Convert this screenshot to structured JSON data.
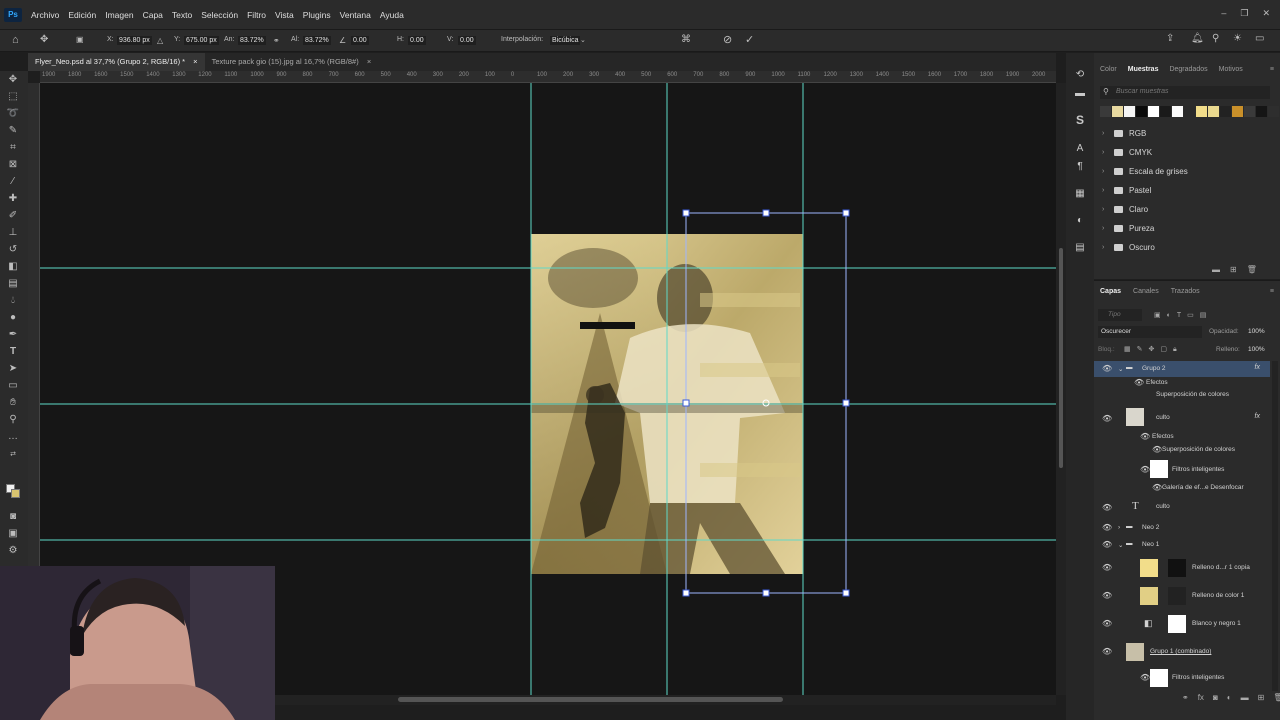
{
  "menubar": {
    "logo": "Ps",
    "items": [
      "Archivo",
      "Edición",
      "Imagen",
      "Capa",
      "Texto",
      "Selección",
      "Filtro",
      "Vista",
      "Plugins",
      "Ventana",
      "Ayuda"
    ]
  },
  "options": {
    "x_label": "X:",
    "x_val": "936.80 px",
    "y_label": "Y:",
    "y_val": "675.00 px",
    "w_label": "An:",
    "w_val": "83.72%",
    "h_label": "Al:",
    "h_val": "83.72%",
    "angle_val": "0.00",
    "hskew_label": "H:",
    "hskew_val": "0.00",
    "vskew_label": "V:",
    "vskew_val": "0.00",
    "interp_label": "Interpolación:",
    "interp_val": "Bicúbica"
  },
  "tabs": [
    {
      "label": "Flyer_Neo.psd al 37,7% (Grupo 2, RGB/16) *",
      "close": "×"
    },
    {
      "label": "Texture pack gio (15).jpg al 16,7% (RGB/8#)",
      "close": "×"
    }
  ],
  "ruler_top": [
    "1900",
    "1800",
    "1600",
    "1500",
    "1400",
    "1300",
    "1200",
    "1100",
    "1000",
    "900",
    "800",
    "700",
    "600",
    "500",
    "400",
    "300",
    "200",
    "100",
    "0",
    "100",
    "200",
    "300",
    "400",
    "500",
    "600",
    "700",
    "800",
    "900",
    "1000",
    "1100",
    "1200",
    "1300",
    "1400",
    "1500",
    "1600",
    "1700",
    "1800",
    "1900",
    "2000"
  ],
  "swatches_panel": {
    "tabs": [
      "Color",
      "Muestras",
      "Degradados",
      "Motivos"
    ],
    "search_placeholder": "Buscar muestras",
    "swatch_colors": [
      "#3a3a3a",
      "#e8d9a0",
      "#f5f5f5",
      "#0a0a0a",
      "#ffffff",
      "#1a1a1a",
      "#fafafa",
      "#2a2a2a",
      "#f2dd8a",
      "#ead98f",
      "#222222",
      "#c9902a",
      "#3a3a3a",
      "#151515",
      "#2e2e2e"
    ],
    "folders": [
      "RGB",
      "CMYK",
      "Escala de grises",
      "Pastel",
      "Claro",
      "Pureza",
      "Oscuro"
    ]
  },
  "layers_panel": {
    "tabs": [
      "Capas",
      "Canales",
      "Trazados"
    ],
    "filter_placeholder": "Tipo",
    "blend_mode": "Oscurecer",
    "opacity_label": "Opacidad:",
    "opacity_val": "100%",
    "lock_label": "Bloq.:",
    "fill_label": "Relleno:",
    "fill_val": "100%",
    "layers": [
      {
        "name": "Grupo 2",
        "kind": "group",
        "fx": "fx",
        "selected": true
      },
      {
        "name": "Efectos",
        "kind": "effects"
      },
      {
        "name": "Superposición de colores",
        "kind": "effect"
      },
      {
        "name": "culto",
        "kind": "smart",
        "fx": "fx"
      },
      {
        "name": "Efectos",
        "kind": "effects"
      },
      {
        "name": "Superposición de colores",
        "kind": "effect"
      },
      {
        "name": "Filtros inteligentes",
        "kind": "smartfilter"
      },
      {
        "name": "Galería de ef...e Desenfocar",
        "kind": "effect"
      },
      {
        "name": "culto",
        "kind": "text"
      },
      {
        "name": "Neo 2",
        "kind": "group"
      },
      {
        "name": "Neo 1",
        "kind": "group"
      },
      {
        "name": "Relleno d...r 1 copia",
        "kind": "fill"
      },
      {
        "name": "Relleno de color 1",
        "kind": "fill"
      },
      {
        "name": "Blanco y negro 1",
        "kind": "adjustment"
      },
      {
        "name": "Grupo 1 (combinado)",
        "kind": "smart"
      },
      {
        "name": "Filtros inteligentes",
        "kind": "smartfilter"
      }
    ]
  }
}
